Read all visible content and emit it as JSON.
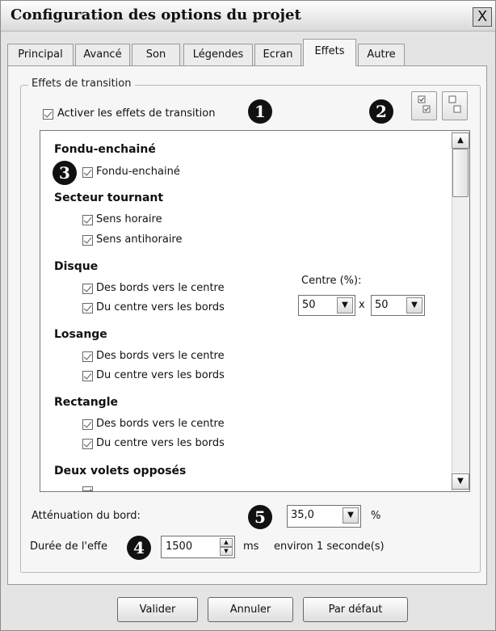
{
  "window": {
    "title": "Configuration des options du projet",
    "close_glyph": "X"
  },
  "tabs": [
    {
      "label": "Principal"
    },
    {
      "label": "Avancé"
    },
    {
      "label": "Son"
    },
    {
      "label": "Légendes"
    },
    {
      "label": "Ecran"
    },
    {
      "label": "Effets",
      "active": true
    },
    {
      "label": "Autre"
    }
  ],
  "group": {
    "legend": "Effets de transition",
    "enable_checkbox_label": "Activer les effets de transition",
    "enable_checked": true
  },
  "callouts": [
    "1",
    "2",
    "3",
    "4",
    "5"
  ],
  "effects": {
    "fondu_header": "Fondu-enchainé",
    "fondu_item": "Fondu-enchainé",
    "secteur_header": "Secteur tournant",
    "secteur_items": [
      "Sens horaire",
      "Sens antihoraire"
    ],
    "disque_header": "Disque",
    "disque_items": [
      "Des bords vers le centre",
      "Du centre vers les bords"
    ],
    "centre_label": "Centre (%):",
    "centre_x": "50",
    "centre_times": "x",
    "centre_y": "50",
    "losange_header": "Losange",
    "losange_items": [
      "Des bords vers le centre",
      "Du centre vers les bords"
    ],
    "rectangle_header": "Rectangle",
    "rectangle_items": [
      "Des bords vers le centre",
      "Du centre vers les bords"
    ],
    "deux_volets_header": "Deux volets opposés"
  },
  "attenuation": {
    "label": "Atténuation du bord:",
    "value": "35,0",
    "unit": "%"
  },
  "duree": {
    "label": "Durée de l'effe",
    "value": "1500",
    "unit": "ms",
    "note": "environ 1 seconde(s)"
  },
  "buttons": {
    "ok": "Valider",
    "cancel": "Annuler",
    "default": "Par défaut"
  },
  "icons": {
    "close": "close-icon",
    "select_all": "check-all-icon",
    "deselect_all": "uncheck-all-icon",
    "scroll_up": "chevron-up-icon",
    "scroll_down": "chevron-down-icon",
    "dropdown": "chevron-down-icon"
  }
}
